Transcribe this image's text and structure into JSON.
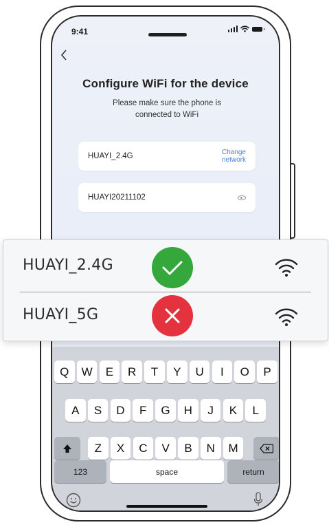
{
  "status_bar": {
    "time": "9:41"
  },
  "screen": {
    "title": "Configure WiFi for the device",
    "subtitle": "Please make sure the phone is connected to WiFi",
    "network_field": {
      "value": "HUAYI_2.4G",
      "link_label": "Change network"
    },
    "password_field": {
      "value": "HUAYI20211102"
    }
  },
  "popup": {
    "rows": [
      {
        "label": "HUAYI_2.4G",
        "status": "check-icon",
        "status_color": "#34a83a"
      },
      {
        "label": "HUAYI_5G",
        "status": "x-icon",
        "status_color": "#e4323f"
      }
    ]
  },
  "keyboard": {
    "row1": [
      "Q",
      "W",
      "E",
      "R",
      "T",
      "Y",
      "U",
      "I",
      "O",
      "P"
    ],
    "row2": [
      "A",
      "S",
      "D",
      "F",
      "G",
      "H",
      "J",
      "K",
      "L"
    ],
    "row3": [
      "Z",
      "X",
      "C",
      "V",
      "B",
      "N",
      "M"
    ],
    "num_label": "123",
    "space_label": "space",
    "return_label": "return"
  }
}
